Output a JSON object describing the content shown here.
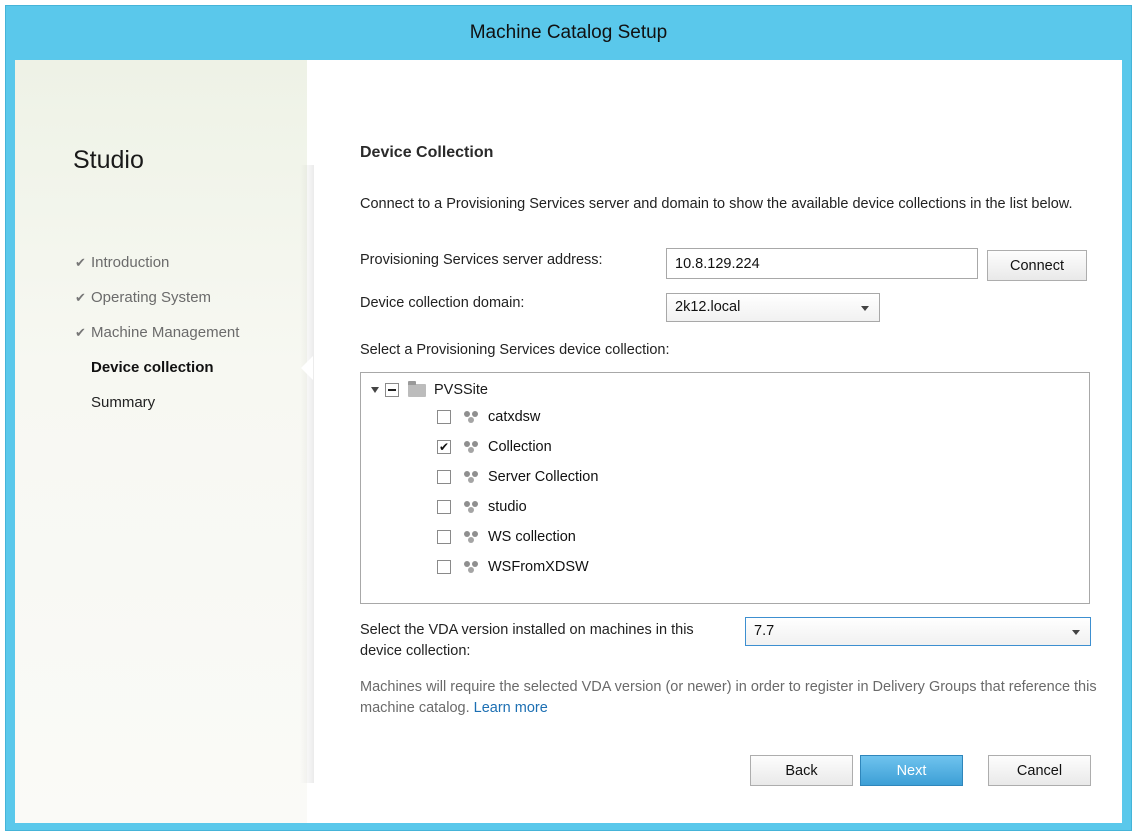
{
  "window": {
    "title": "Machine Catalog Setup"
  },
  "sidebar": {
    "brand": "Studio",
    "steps": [
      {
        "label": "Introduction",
        "state": "done"
      },
      {
        "label": "Operating System",
        "state": "done"
      },
      {
        "label": "Machine Management",
        "state": "done"
      },
      {
        "label": "Device collection",
        "state": "current"
      },
      {
        "label": "Summary",
        "state": "pending"
      }
    ]
  },
  "main": {
    "heading": "Device Collection",
    "intro": "Connect to a Provisioning Services server and domain to show the available device collections in the list below.",
    "server": {
      "label": "Provisioning Services server address:",
      "value": "10.8.129.224",
      "connect_label": "Connect"
    },
    "domain": {
      "label": "Device collection domain:",
      "value": "2k12.local"
    },
    "collection_prompt": "Select a Provisioning Services device collection:",
    "tree": {
      "root": {
        "label": "PVSSite",
        "expanded": true,
        "check_state": "partial"
      },
      "items": [
        {
          "label": "catxdsw",
          "checked": false
        },
        {
          "label": "Collection",
          "checked": true
        },
        {
          "label": "Server Collection",
          "checked": false
        },
        {
          "label": "studio",
          "checked": false
        },
        {
          "label": "WS collection",
          "checked": false
        },
        {
          "label": "WSFromXDSW",
          "checked": false
        }
      ]
    },
    "vda": {
      "label": "Select the VDA version installed on machines in this device collection:",
      "value": "7.7"
    },
    "note": {
      "text": "Machines will require the selected VDA version (or newer) in order to register in Delivery Groups that reference this machine catalog.",
      "link": "Learn more"
    }
  },
  "footer": {
    "back_label": "Back",
    "next_label": "Next",
    "cancel_label": "Cancel"
  },
  "colors": {
    "titlebar": "#5ac8eb",
    "primary_button": "#3d9fd6",
    "link": "#1c6fb3"
  },
  "icons": {
    "check": "checkmark-icon",
    "folder": "folder-icon",
    "collection": "device-collection-icon",
    "dropdown": "chevron-down-icon"
  }
}
